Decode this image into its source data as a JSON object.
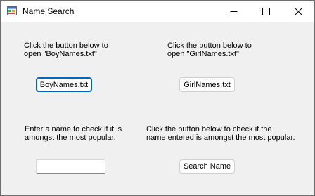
{
  "window": {
    "title": "Name Search",
    "app_icon": "winforms-app-icon",
    "controls": {
      "minimize_icon": "minimize-icon",
      "maximize_icon": "maximize-icon",
      "close_icon": "close-icon"
    }
  },
  "boy_section": {
    "instruction": "Click the button below to\nopen \"BoyNames.txt\"",
    "button_label": "BoyNames.txt"
  },
  "girl_section": {
    "instruction": "Click the button below to\nopen \"GirlNames.txt\"",
    "button_label": "GirlNames.txt"
  },
  "name_entry": {
    "instruction": "Enter a name to check if it is\namongst the most popular.",
    "value": "",
    "placeholder": ""
  },
  "search_section": {
    "instruction": "Click the button below to check if the\nname entered is amongst the most popular.",
    "button_label": "Search Name"
  },
  "colors": {
    "form_background": "#f0f0f0",
    "titlebar_background": "#ffffff",
    "focus_accent": "#0067c0"
  }
}
